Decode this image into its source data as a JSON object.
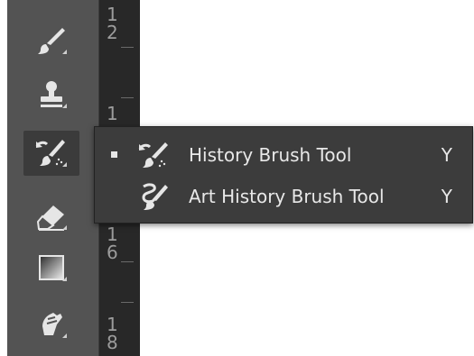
{
  "toolbar": {
    "tools": [
      {
        "name": "brush-tool",
        "icon": "brush-icon"
      },
      {
        "name": "clone-stamp-tool",
        "icon": "stamp-icon"
      },
      {
        "name": "history-brush-tool",
        "icon": "history-brush-icon",
        "active": true
      },
      {
        "name": "eraser-tool",
        "icon": "eraser-icon"
      },
      {
        "name": "gradient-tool",
        "icon": "gradient-icon"
      },
      {
        "name": "smudge-tool",
        "icon": "smudge-icon"
      }
    ]
  },
  "ruler": {
    "labels": [
      "1",
      "2",
      "1",
      "1",
      "6",
      "1",
      "8"
    ]
  },
  "flyout": {
    "items": [
      {
        "label": "History Brush Tool",
        "shortcut": "Y",
        "selected": true,
        "icon": "history-brush-icon"
      },
      {
        "label": "Art History Brush Tool",
        "shortcut": "Y",
        "selected": false,
        "icon": "art-history-brush-icon"
      }
    ]
  },
  "colors": {
    "toolbar_bg": "#535353",
    "ruler_bg": "#282828",
    "flyout_bg": "#3c3c3c",
    "text": "#e8e8e8"
  }
}
